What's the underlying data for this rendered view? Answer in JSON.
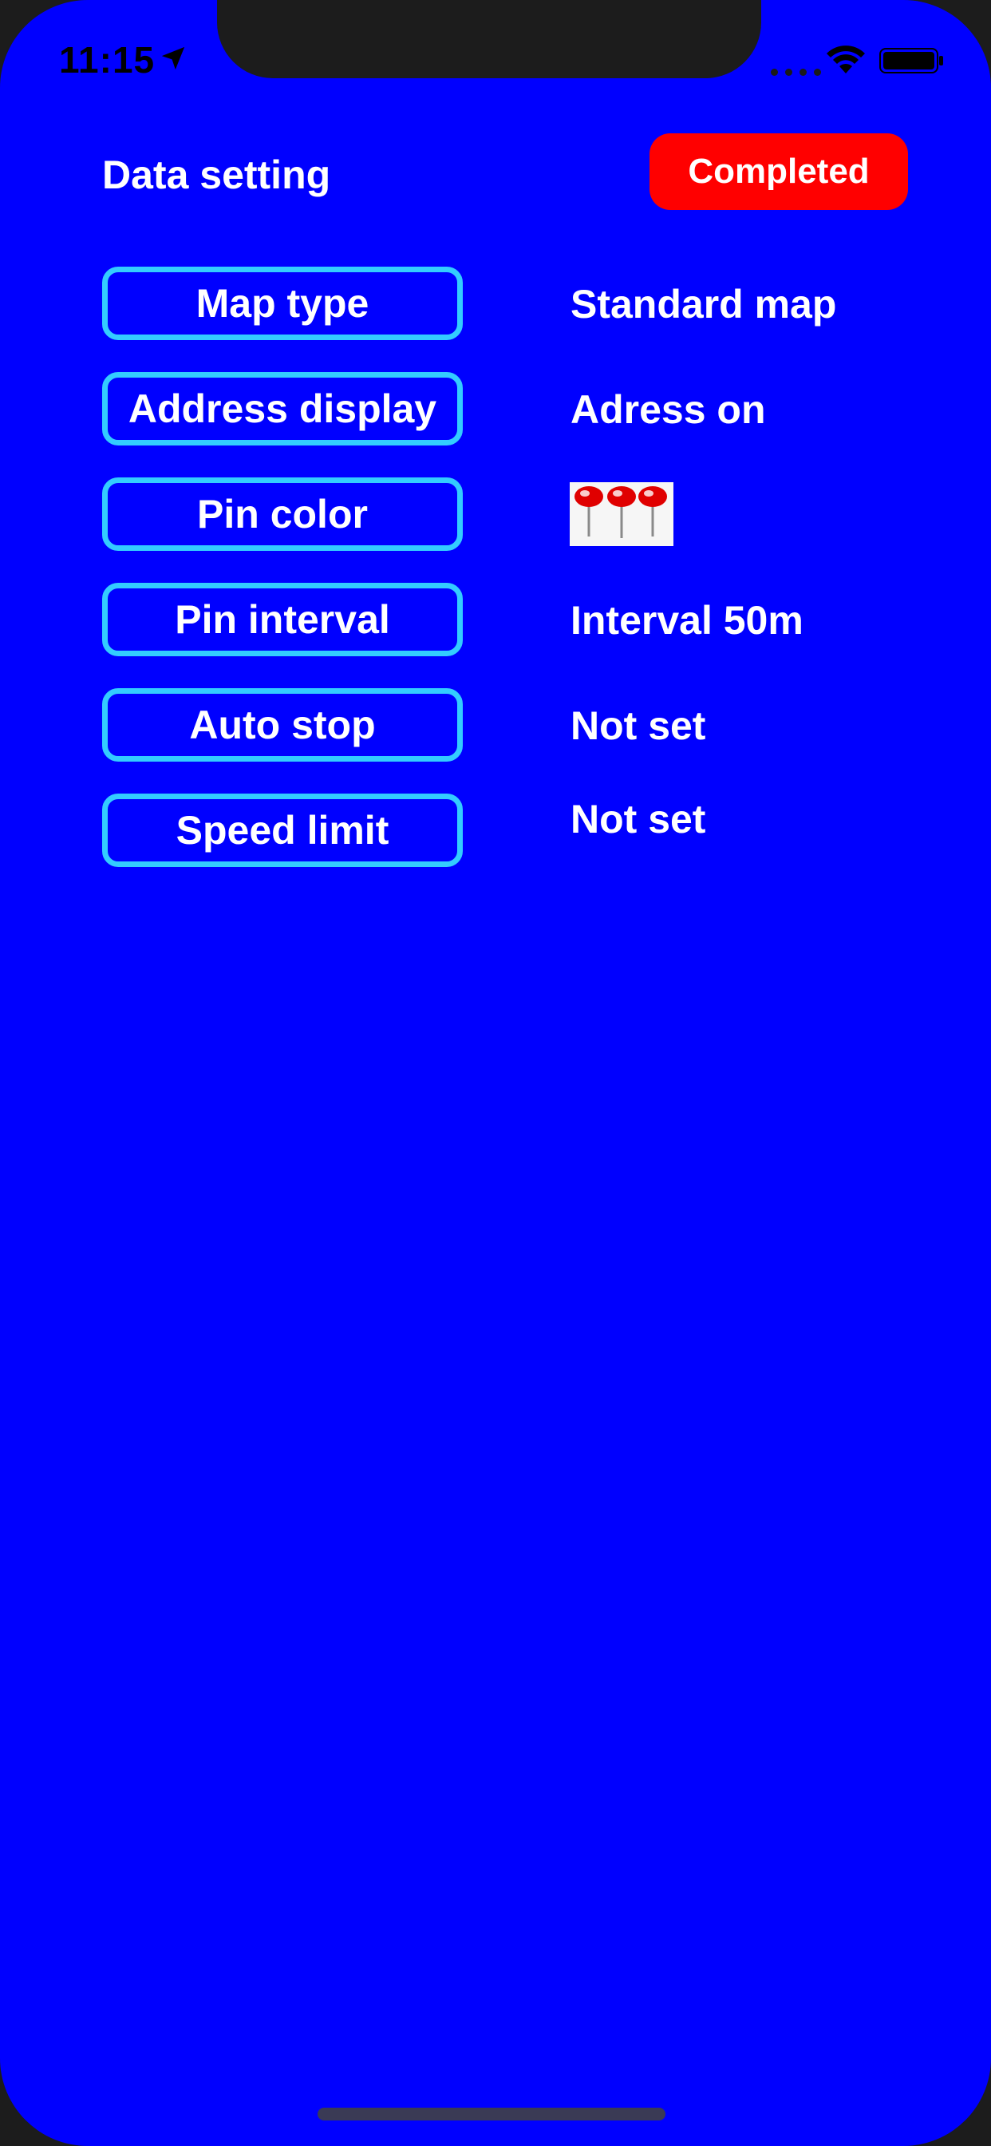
{
  "status_bar": {
    "time": "11:15"
  },
  "header": {
    "title": "Data setting",
    "completed_label": "Completed"
  },
  "settings": [
    {
      "label": "Map type",
      "value": "Standard map"
    },
    {
      "label": "Address display",
      "value": "Adress on"
    },
    {
      "label": "Pin color",
      "value_icon": "red-pins-icon"
    },
    {
      "label": "Pin interval",
      "value": "Interval 50m"
    },
    {
      "label": "Auto stop",
      "value": "Not set"
    },
    {
      "label": "Speed limit",
      "value": "Not set"
    }
  ],
  "colors": {
    "background": "#0000ff",
    "button_border": "#33ccff",
    "completed_button": "#ff0000",
    "text": "#ffffff"
  }
}
